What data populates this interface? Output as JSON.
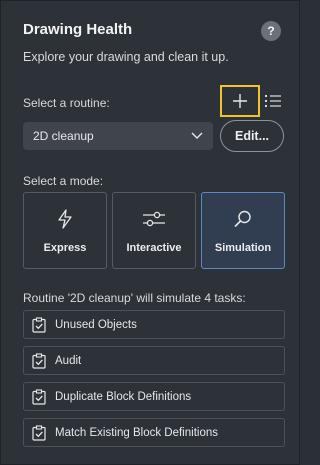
{
  "header": {
    "title": "Drawing Health",
    "help_label": "?",
    "subtitle": "Explore your drawing and clean it up."
  },
  "routine": {
    "label": "Select a routine:",
    "selected": "2D cleanup",
    "edit_label": "Edit..."
  },
  "mode": {
    "label": "Select a mode:",
    "options": [
      {
        "label": "Express",
        "icon": "lightning-icon",
        "selected": false
      },
      {
        "label": "Interactive",
        "icon": "sliders-icon",
        "selected": false
      },
      {
        "label": "Simulation",
        "icon": "search-icon",
        "selected": true
      }
    ]
  },
  "summary": "Routine '2D cleanup' will simulate 4 tasks:",
  "tasks": [
    {
      "label": "Unused Objects",
      "icon": "checkbox-clipboard-icon"
    },
    {
      "label": "Audit",
      "icon": "checkbox-clipboard-icon"
    },
    {
      "label": "Duplicate Block Definitions",
      "icon": "checkbox-clipboard-icon"
    },
    {
      "label": "Match Existing Block Definitions",
      "icon": "checkbox-clipboard-icon"
    }
  ],
  "colors": {
    "panel_bg": "#2d3138",
    "highlight_outline": "#f2c230",
    "selected_mode_border": "#5c8ac4",
    "selected_mode_bg": "#313e52"
  }
}
